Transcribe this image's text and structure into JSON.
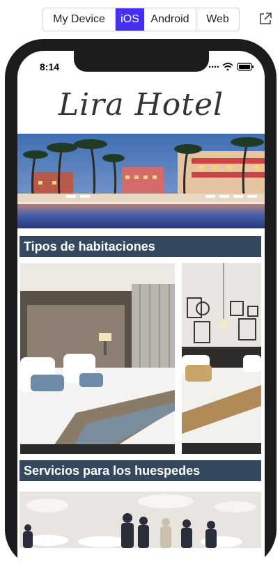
{
  "toolbar": {
    "options": [
      "My Device",
      "iOS",
      "Android",
      "Web"
    ],
    "selected": "iOS",
    "accent_color": "#4630eb",
    "popout_icon": "external-link-icon"
  },
  "status_bar": {
    "time": "8:14",
    "icons": [
      "signal-icon",
      "wifi-icon",
      "battery-icon"
    ]
  },
  "app": {
    "logo_text": "Lira Hotel",
    "sections": [
      {
        "title": "Tipos de habitaciones"
      },
      {
        "title": "Servicios para los huespedes"
      }
    ],
    "header_color": "#34495e"
  }
}
